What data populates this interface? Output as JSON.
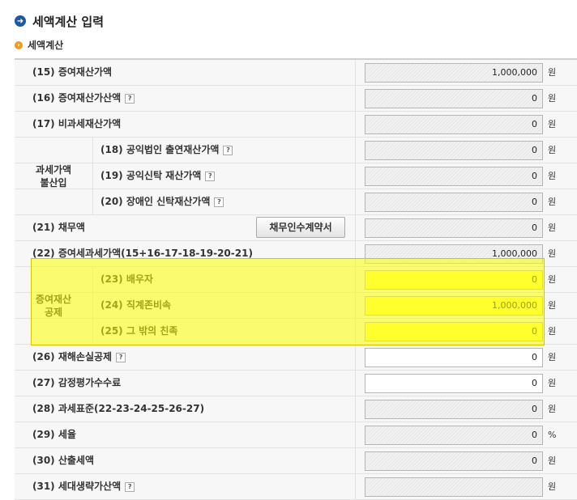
{
  "header": {
    "title": "세액계산 입력",
    "title_icon": "arrow-right-icon"
  },
  "section": {
    "title": "세액계산",
    "icon": "arrow-right-small-icon"
  },
  "groups": {
    "exclusion": "과세가액\n불산입",
    "deduction": "증여재산\n공제"
  },
  "rows": [
    {
      "label": "(15) 증여재산가액",
      "value": "1,000,000",
      "unit": "원"
    },
    {
      "label": "(16) 증여재산가산액",
      "value": "0",
      "unit": "원"
    },
    {
      "label": "(17) 비과세재산가액",
      "value": "0",
      "unit": "원"
    },
    {
      "label": "(18) 공익법인 출연재산가액",
      "value": "0",
      "unit": "원"
    },
    {
      "label": "(19) 공익신탁 재산가액",
      "value": "0",
      "unit": "원"
    },
    {
      "label": "(20) 장애인 신탁재산가액",
      "value": "0",
      "unit": "원"
    },
    {
      "label": "(21) 채무액",
      "value": "0",
      "unit": "원",
      "button": "채무인수계약서"
    },
    {
      "label": "(22) 증여세과세가액(15+16-17-18-19-20-21)",
      "value": "1,000,000",
      "unit": "원"
    },
    {
      "label": "(23) 배우자",
      "value": "0",
      "unit": "원"
    },
    {
      "label": "(24) 직계존비속",
      "value": "1,000,000",
      "unit": "원"
    },
    {
      "label": "(25) 그 밖의 친족",
      "value": "0",
      "unit": "원"
    },
    {
      "label": "(26) 재해손실공제",
      "value": "0",
      "unit": "원"
    },
    {
      "label": "(27) 감정평가수수료",
      "value": "0",
      "unit": "원"
    },
    {
      "label": "(28) 과세표준(22-23-24-25-26-27)",
      "value": "0",
      "unit": "원"
    },
    {
      "label": "(29) 세율",
      "value": "0",
      "unit": "%"
    },
    {
      "label": "(30) 산출세액",
      "value": "0",
      "unit": "원"
    },
    {
      "label": "(31) 세대생략가산액",
      "value": "",
      "unit": "원"
    }
  ],
  "help_glyph": "?"
}
